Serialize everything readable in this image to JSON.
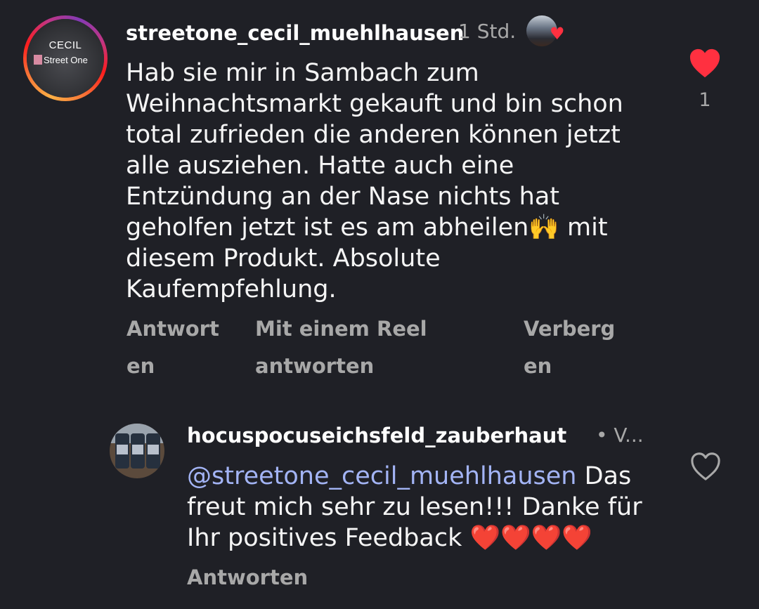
{
  "colors": {
    "background": "#1f2026",
    "text_primary": "#f5f5f5",
    "text_secondary": "#a8a8a8",
    "like_red": "#ff3040",
    "mention_blue": "#a3b4f5"
  },
  "comment": {
    "avatar": {
      "brand_top": "CECIL",
      "brand_bottom": "Street One",
      "icon": "story-ring-avatar"
    },
    "username": "streetone_cecil_muehlhausen",
    "time": "1 Std.",
    "liked_by_creator_icon": "heart-icon",
    "body_lines": [
      "Hab sie mir in Sambach zum",
      "Weihnachtsmarkt gekauft und bin schon",
      "total zufrieden die anderen können jetzt",
      "alle ausziehen. Hatte auch eine",
      "Entzündung an der Nase nichts hat",
      "geholfen jetzt ist es am abheilen🙌 mit",
      "diesem Produkt. Absolute",
      "Kaufempfehlung."
    ],
    "actions": {
      "reply": [
        "Antwort",
        "en"
      ],
      "reel_reply": [
        "Mit einem Reel",
        "antworten"
      ],
      "hide": [
        "Verberg",
        "en"
      ]
    },
    "like": {
      "liked": true,
      "count": "1",
      "icon": "heart-filled-icon"
    }
  },
  "reply": {
    "username": "hocuspocuseichsfeld_zauberhaut",
    "time": "• V...",
    "mention": "@streetone_cecil_muehlhausen",
    "body_first_suffix": " Das",
    "body_lines": [
      "freut mich sehr zu lesen!!! Danke für",
      "Ihr positives Feedback "
    ],
    "hearts": "❤️❤️❤️❤️",
    "action_reply": "Antworten",
    "like": {
      "liked": false,
      "icon": "heart-outline-icon"
    }
  }
}
